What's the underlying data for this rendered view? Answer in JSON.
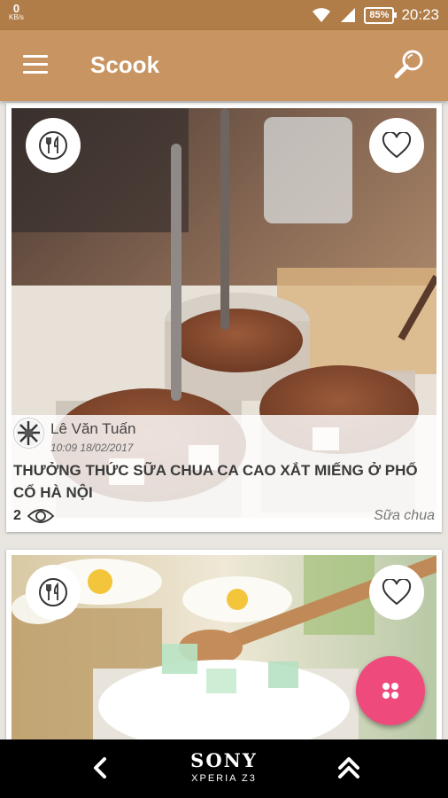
{
  "status_bar": {
    "net_speed": "0",
    "net_unit": "KB/s",
    "battery": "85%",
    "time": "20:23"
  },
  "app_bar": {
    "title": "Scook"
  },
  "posts": [
    {
      "author": "Lê Văn Tuấn",
      "date": "10:09 18/02/2017",
      "title": "THƯỞNG THỨC SỮA CHUA CA CAO XẮT MIẾNG Ở PHỐ CỔ HÀ NỘI",
      "views": "2",
      "category": "Sữa chua"
    },
    {}
  ],
  "nav_bar": {
    "brand": "SONY",
    "model": "XPERIA Z3"
  },
  "icons": [
    "menu-icon",
    "search-icon",
    "fork-knife-icon",
    "heart-icon",
    "eye-icon",
    "apps-icon",
    "back-arrow-icon",
    "double-chevron-up-icon",
    "wifi-icon",
    "signal-icon",
    "battery-icon"
  ],
  "colors": {
    "status_bar": "#b07c47",
    "app_bar": "#c89461",
    "fab": "#ee4b7c",
    "nav_bar": "#000000"
  }
}
